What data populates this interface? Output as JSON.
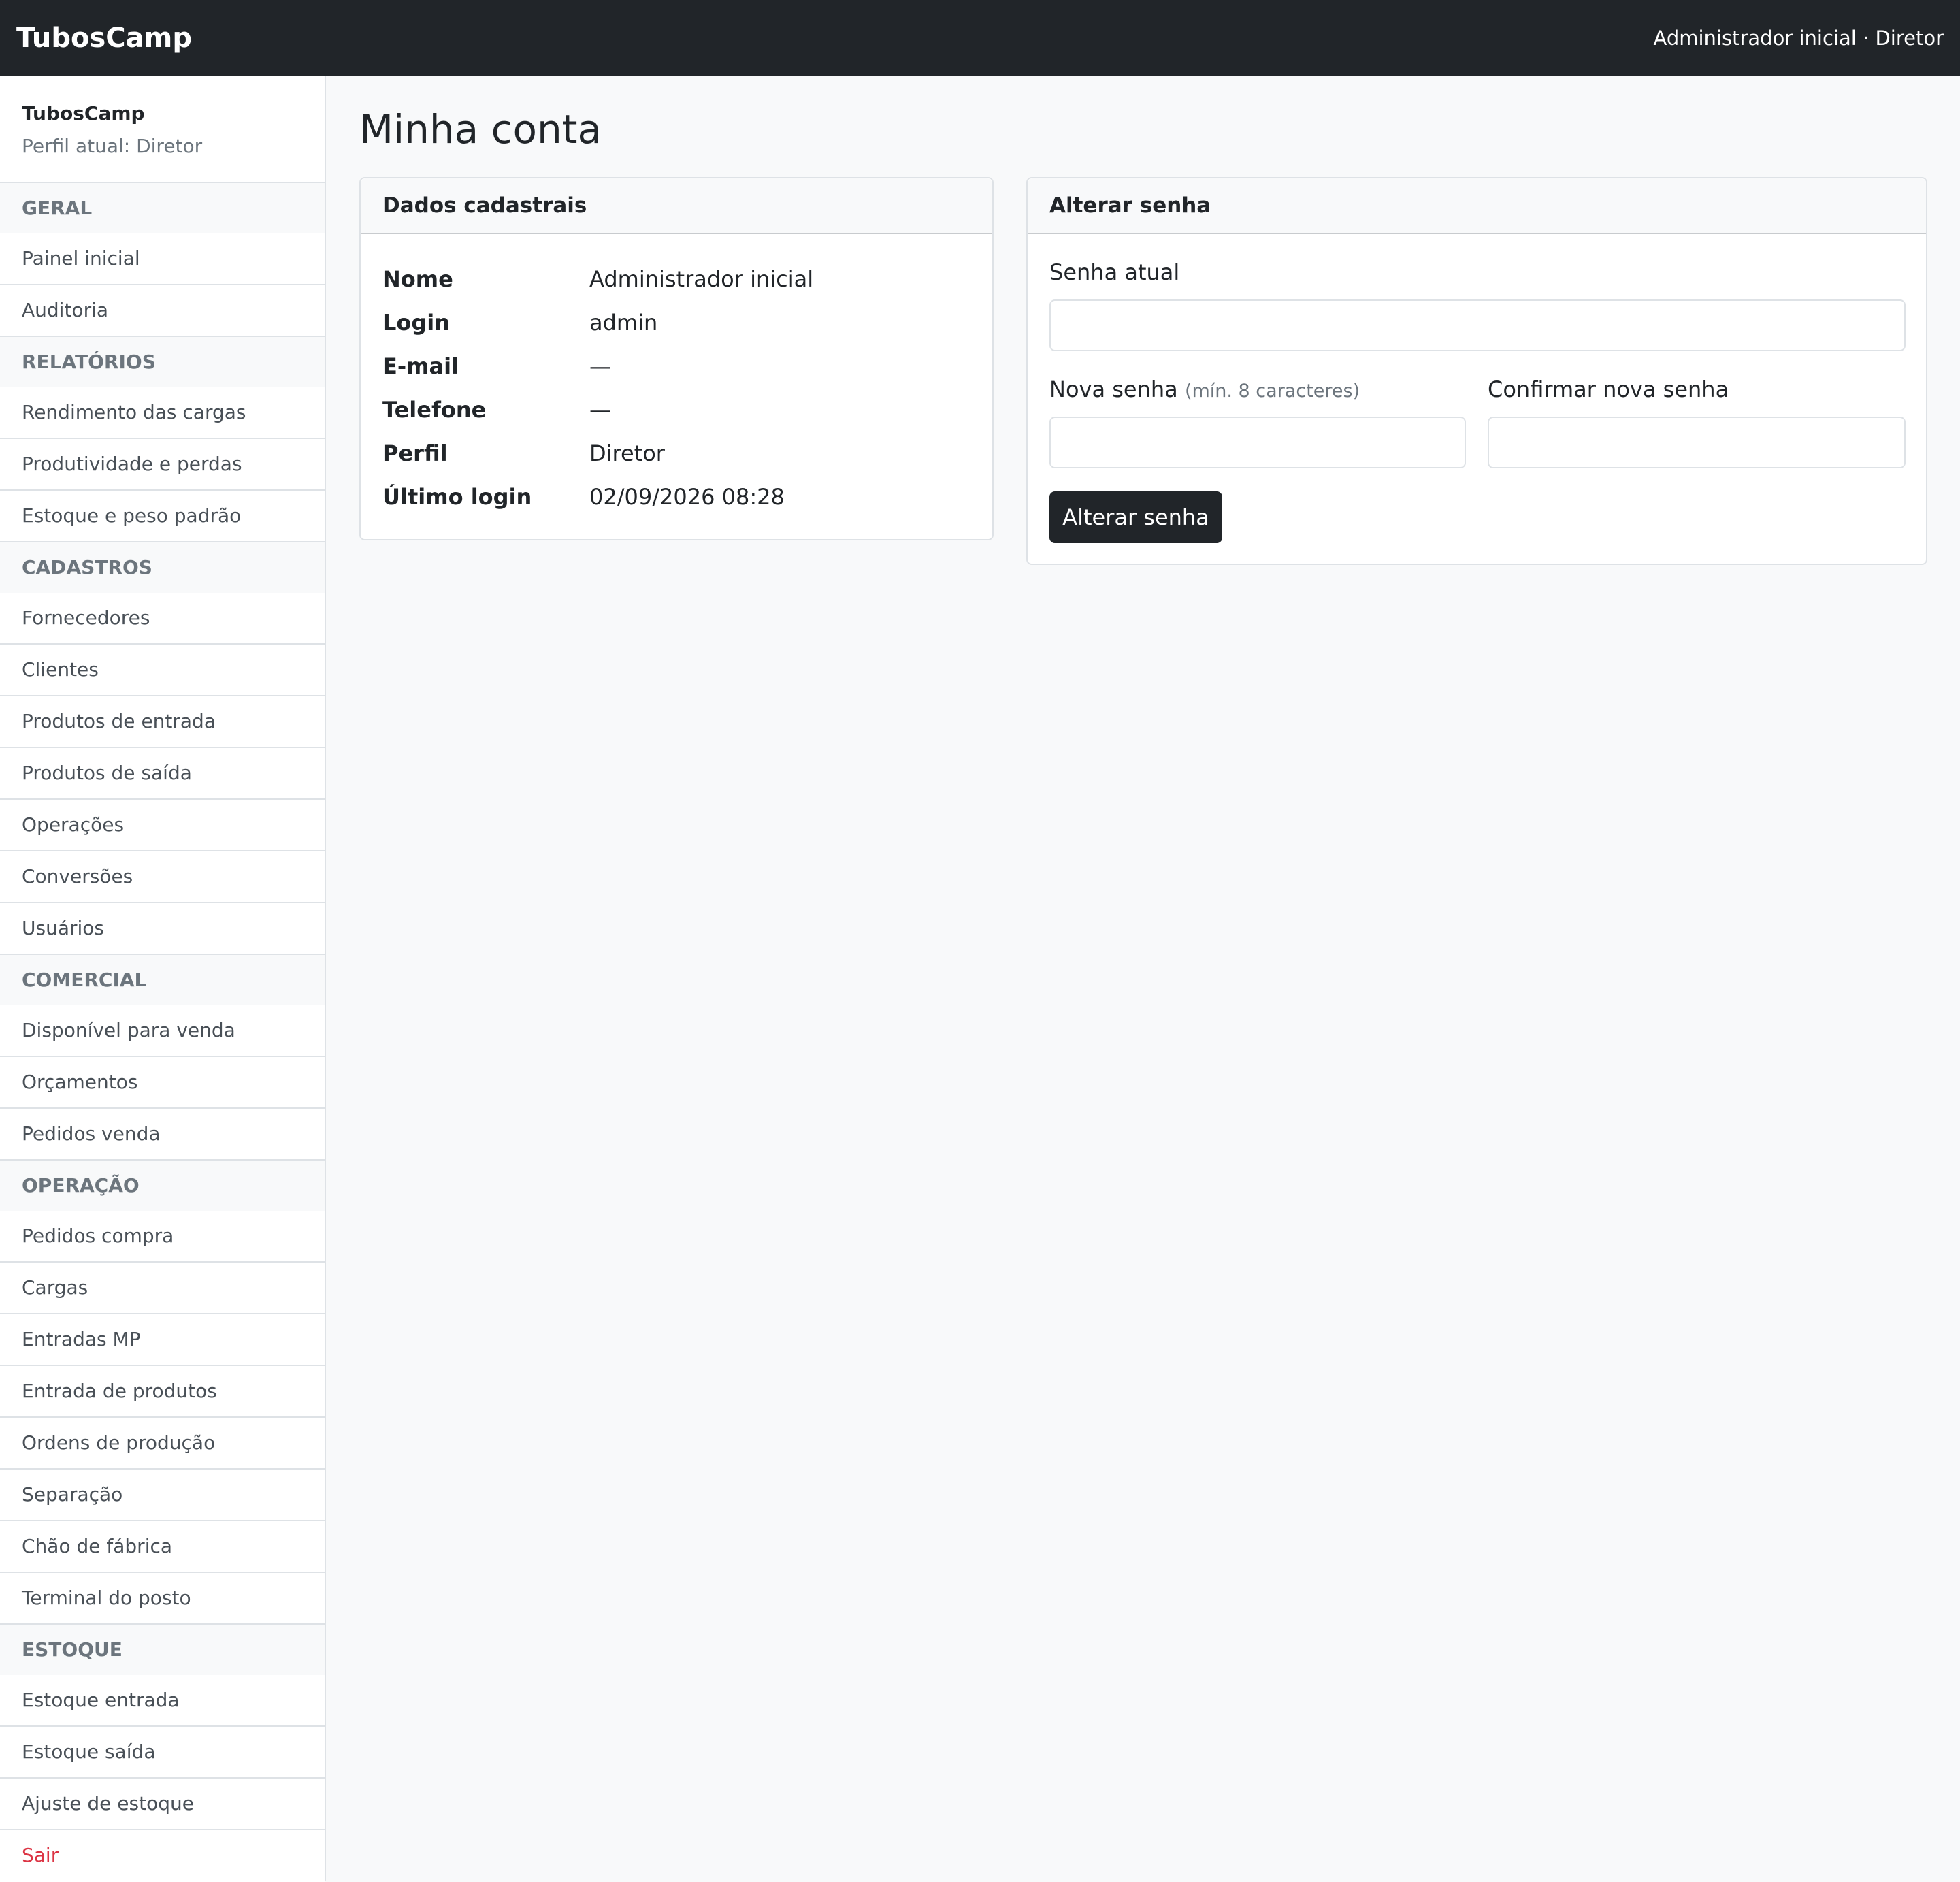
{
  "navbar": {
    "brand": "TubosCamp",
    "user_info": "Administrador inicial · Diretor"
  },
  "sidebar": {
    "title": "TubosCamp",
    "subtitle": "Perfil atual: Diretor",
    "sections": [
      {
        "label": "GERAL",
        "items": [
          "Painel inicial",
          "Auditoria"
        ]
      },
      {
        "label": "RELATÓRIOS",
        "items": [
          "Rendimento das cargas",
          "Produtividade e perdas",
          "Estoque e peso padrão"
        ]
      },
      {
        "label": "CADASTROS",
        "items": [
          "Fornecedores",
          "Clientes",
          "Produtos de entrada",
          "Produtos de saída",
          "Operações",
          "Conversões",
          "Usuários"
        ]
      },
      {
        "label": "COMERCIAL",
        "items": [
          "Disponível para venda",
          "Orçamentos",
          "Pedidos venda"
        ]
      },
      {
        "label": "OPERAÇÃO",
        "items": [
          "Pedidos compra",
          "Cargas",
          "Entradas MP",
          "Entrada de produtos",
          "Ordens de produção",
          "Separação",
          "Chão de fábrica",
          "Terminal do posto"
        ]
      },
      {
        "label": "ESTOQUE",
        "items": [
          "Estoque entrada",
          "Estoque saída",
          "Ajuste de estoque"
        ]
      }
    ],
    "logout": "Sair"
  },
  "page": {
    "title": "Minha conta"
  },
  "info_card": {
    "header": "Dados cadastrais",
    "rows": [
      {
        "label": "Nome",
        "value": "Administrador inicial"
      },
      {
        "label": "Login",
        "value": "admin"
      },
      {
        "label": "E-mail",
        "value": "—"
      },
      {
        "label": "Telefone",
        "value": "—"
      },
      {
        "label": "Perfil",
        "value": "Diretor"
      },
      {
        "label": "Último login",
        "value": "02/09/2026 08:28"
      }
    ]
  },
  "password_card": {
    "header": "Alterar senha",
    "current_label": "Senha atual",
    "new_label": "Nova senha",
    "new_hint": "(mín. 8 caracteres)",
    "confirm_label": "Confirmar nova senha",
    "submit_label": "Alterar senha"
  }
}
